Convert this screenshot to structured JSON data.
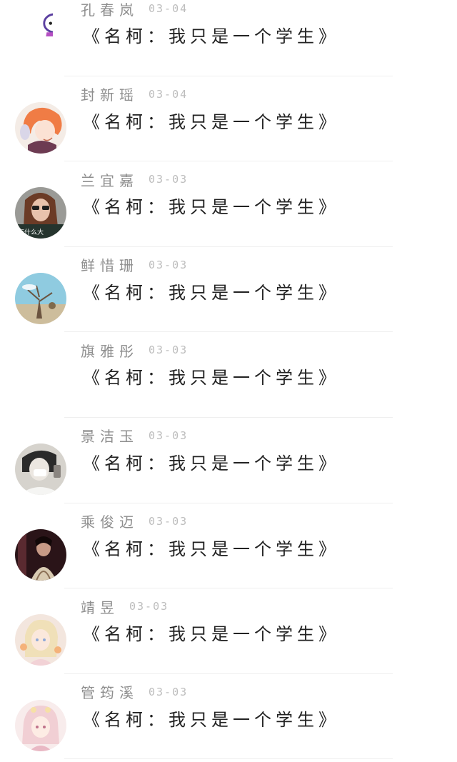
{
  "comments": [
    {
      "name": "孔春岚",
      "date": "03-04",
      "text": "《名柯：我只是一个学生》",
      "avatar": "cartoon-character-avatar"
    },
    {
      "name": "封新瑶",
      "date": "03-04",
      "text": "《名柯：我只是一个学生》",
      "avatar": "anime-orange-hair-avatar"
    },
    {
      "name": "兰宜嘉",
      "date": "03-03",
      "text": "《名柯：我只是一个学生》",
      "avatar": "woman-sunglasses-avatar"
    },
    {
      "name": "鲜惜珊",
      "date": "03-03",
      "text": "《名柯：我只是一个学生》",
      "avatar": "tree-landscape-avatar"
    },
    {
      "name": "旗雅彤",
      "date": "03-03",
      "text": "《名柯：我只是一个学生》",
      "avatar": "none"
    },
    {
      "name": "景洁玉",
      "date": "03-03",
      "text": "《名柯：我只是一个学生》",
      "avatar": "person-mask-avatar"
    },
    {
      "name": "乘俊迈",
      "date": "03-03",
      "text": "《名柯：我只是一个学生》",
      "avatar": "dark-portrait-avatar"
    },
    {
      "name": "靖昱",
      "date": "03-03",
      "text": "《名柯：我只是一个学生》",
      "avatar": "anime-blonde-girl-avatar"
    },
    {
      "name": "管筠溪",
      "date": "03-03",
      "text": "《名柯：我只是一个学生》",
      "avatar": "anime-pink-girl-avatar"
    }
  ]
}
